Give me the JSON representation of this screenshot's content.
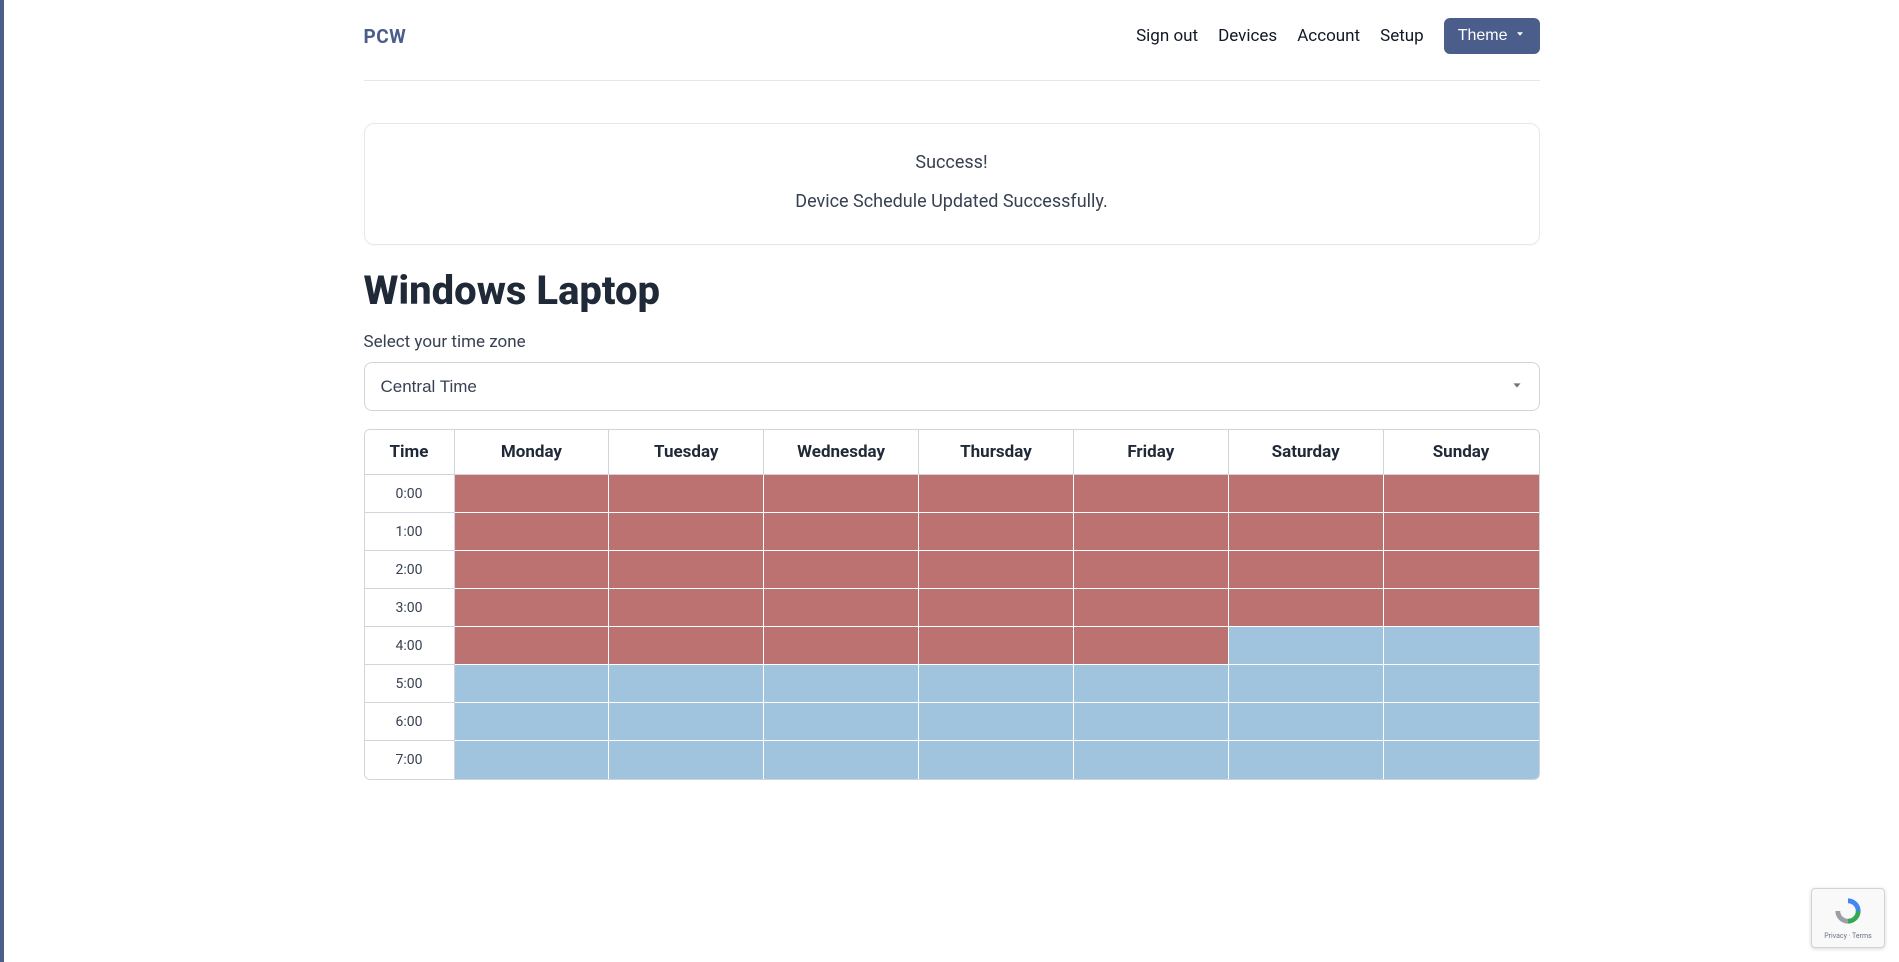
{
  "brand": "PCW",
  "nav": {
    "signout": "Sign out",
    "devices": "Devices",
    "account": "Account",
    "setup": "Setup",
    "theme": "Theme"
  },
  "alert": {
    "title": "Success!",
    "message": "Device Schedule Updated Successfully."
  },
  "page_title": "Windows Laptop",
  "tz_label": "Select your time zone",
  "tz_value": "Central Time",
  "schedule": {
    "headers": [
      "Time",
      "Monday",
      "Tuesday",
      "Wednesday",
      "Thursday",
      "Friday",
      "Saturday",
      "Sunday"
    ],
    "rows": [
      {
        "time": "0:00",
        "cells": [
          "red",
          "red",
          "red",
          "red",
          "red",
          "red",
          "red"
        ]
      },
      {
        "time": "1:00",
        "cells": [
          "red",
          "red",
          "red",
          "red",
          "red",
          "red",
          "red"
        ]
      },
      {
        "time": "2:00",
        "cells": [
          "red",
          "red",
          "red",
          "red",
          "red",
          "red",
          "red"
        ]
      },
      {
        "time": "3:00",
        "cells": [
          "red",
          "red",
          "red",
          "red",
          "red",
          "red",
          "red"
        ]
      },
      {
        "time": "4:00",
        "cells": [
          "red",
          "red",
          "red",
          "red",
          "red",
          "blue",
          "blue"
        ]
      },
      {
        "time": "5:00",
        "cells": [
          "blue",
          "blue",
          "blue",
          "blue",
          "blue",
          "blue",
          "blue"
        ]
      },
      {
        "time": "6:00",
        "cells": [
          "blue",
          "blue",
          "blue",
          "blue",
          "blue",
          "blue",
          "blue"
        ]
      },
      {
        "time": "7:00",
        "cells": [
          "blue",
          "blue",
          "blue",
          "blue",
          "blue",
          "blue",
          "blue"
        ]
      }
    ]
  },
  "recaptcha": "Privacy · Terms"
}
